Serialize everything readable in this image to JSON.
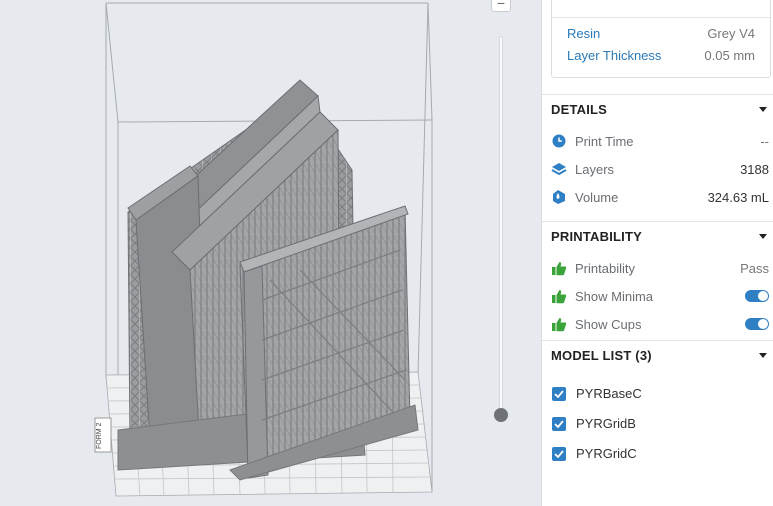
{
  "material": {
    "resin_label": "Resin",
    "resin_value": "Grey V4",
    "layer_label": "Layer Thickness",
    "layer_value": "0.05 mm"
  },
  "details": {
    "title": "DETAILS",
    "rows": [
      {
        "icon": "clock-icon",
        "label": "Print Time",
        "value": "--"
      },
      {
        "icon": "layers-icon",
        "label": "Layers",
        "value": "3188"
      },
      {
        "icon": "volume-drop-icon",
        "label": "Volume",
        "value": "324.63 mL"
      }
    ]
  },
  "printability": {
    "title": "PRINTABILITY",
    "rows": [
      {
        "icon": "thumbs-up-icon",
        "label": "Printability",
        "value": "Pass"
      },
      {
        "icon": "thumbs-up-icon",
        "label": "Show Minima",
        "toggle": true
      },
      {
        "icon": "thumbs-up-icon",
        "label": "Show Cups",
        "toggle": true
      }
    ]
  },
  "model_list": {
    "title": "MODEL LIST (3)",
    "items": [
      {
        "label": "PYRBaseC",
        "checked": true
      },
      {
        "label": "PYRGridB",
        "checked": true
      },
      {
        "label": "PYRGridC",
        "checked": true
      }
    ]
  },
  "viewport": {
    "zoom_out_label": "−",
    "printer_tag": "FORM 2",
    "layer_slider_position": 0.0
  },
  "colors": {
    "accent": "#2f7fc4",
    "link": "#2a7ab8",
    "thumbs": "#3aa33a",
    "model_gray": "#8c8f92"
  }
}
